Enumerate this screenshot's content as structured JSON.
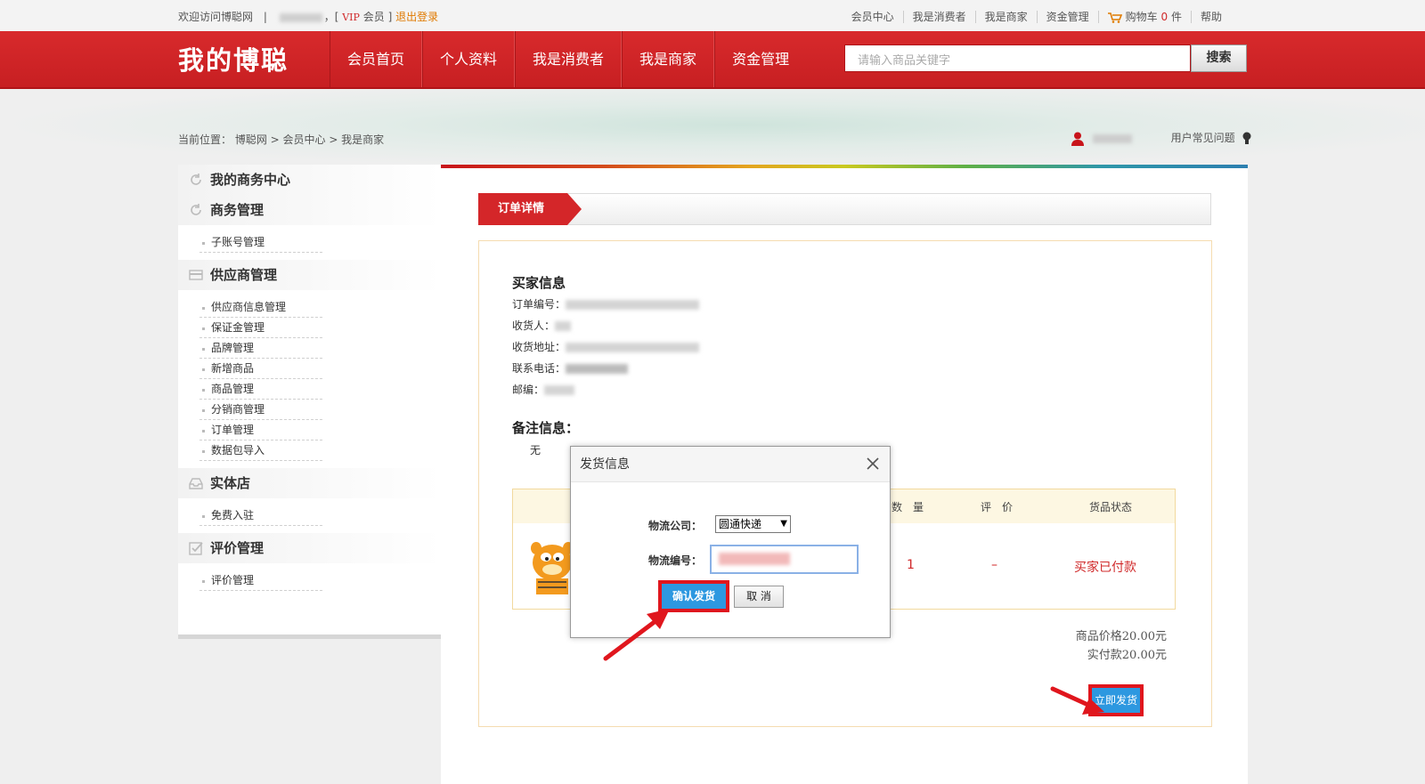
{
  "topbar": {
    "welcome": "欢迎访问博聪网",
    "sep": "|",
    "comma_bracket": "，[",
    "vip": "VIP",
    "member": "会员",
    "close_bracket": "]",
    "logout": "退出登录",
    "links": [
      "会员中心",
      "我是消费者",
      "我是商家",
      "资金管理"
    ],
    "cart_label": "购物车",
    "cart_count": "0",
    "cart_unit": "件",
    "help": "帮助"
  },
  "header": {
    "brand": "我的博聪",
    "nav": [
      "会员首页",
      "个人资料",
      "我是消费者",
      "我是商家",
      "资金管理"
    ],
    "search_placeholder": "请输入商品关键字",
    "search_button": "搜索"
  },
  "breadcrumb": "当前位置：  博聪网  >  会员中心  >  我是商家",
  "user_faq": "用户常见问题",
  "sidebar": {
    "sections": [
      {
        "title": "我的商务中心",
        "items": []
      },
      {
        "title": "商务管理",
        "items": [
          "子账号管理"
        ]
      },
      {
        "title": "供应商管理",
        "items": [
          "供应商信息管理",
          "保证金管理",
          "品牌管理",
          "新增商品",
          "商品管理",
          "分销商管理",
          "订单管理",
          "数据包导入"
        ]
      },
      {
        "title": "实体店",
        "items": [
          "免费入驻"
        ]
      },
      {
        "title": "评价管理",
        "items": [
          "评价管理"
        ]
      }
    ]
  },
  "main": {
    "tab": "订单详情",
    "buyer_title": "买家信息",
    "buyer_fields": [
      "订单编号：",
      "收货人：",
      "收货地址：",
      "联系电话：",
      "邮编："
    ],
    "remark_title": "备注信息：",
    "remark_value": "无",
    "table": {
      "headers": [
        "数　量",
        "评　价",
        "货品状态"
      ],
      "row": {
        "quantity": "1",
        "rating": "–",
        "status": "买家已付款"
      }
    },
    "goods_price": "商品价格20.00元",
    "paid": "实付款20.00元",
    "ship_now": "立即发货"
  },
  "modal": {
    "title": "发货信息",
    "company_label": "物流公司：",
    "company_value": "圆通快递",
    "number_label": "物流编号：",
    "confirm": "确认发货",
    "cancel": "取 消"
  },
  "colors": {
    "brand_red": "#d42629",
    "highlight_red": "#e0161d",
    "button_blue": "#2d98e0"
  }
}
